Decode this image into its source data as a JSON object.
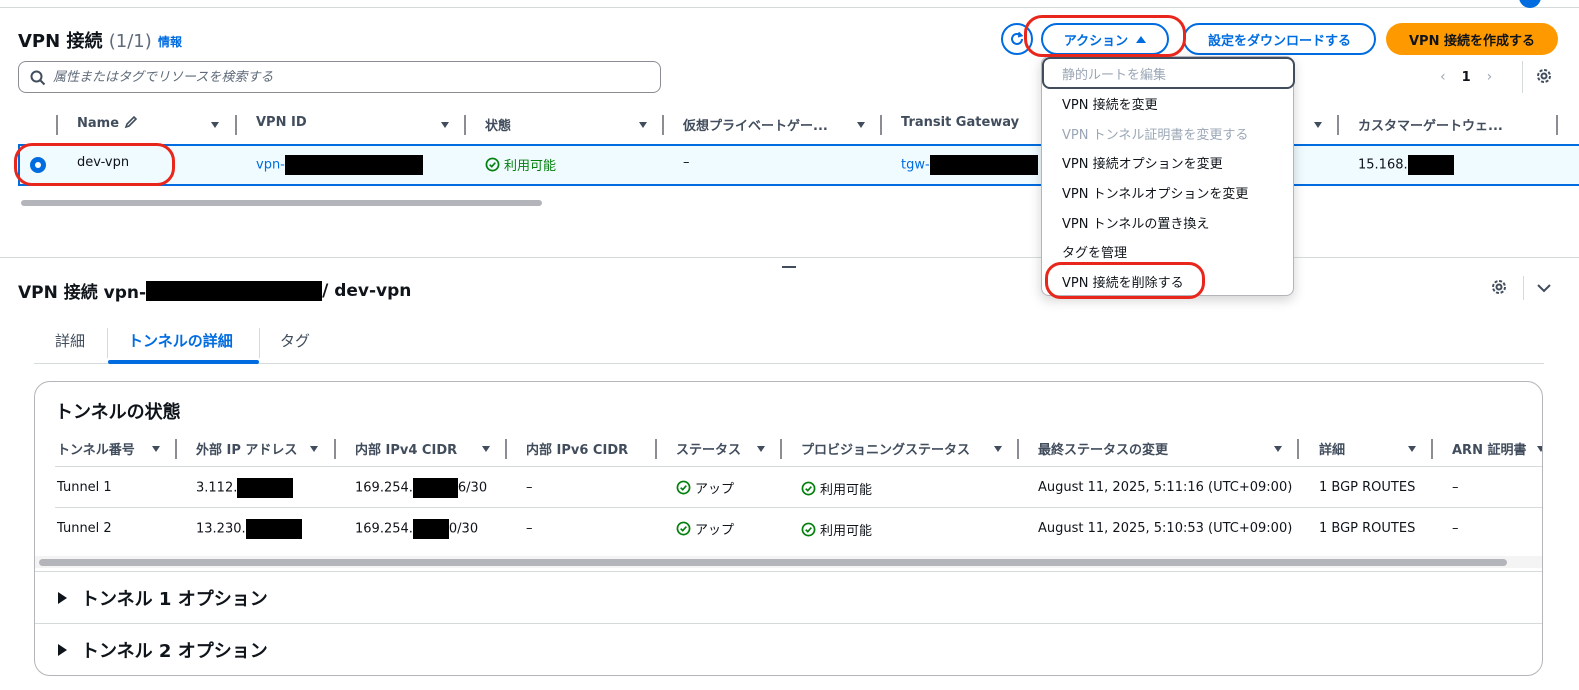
{
  "header": {
    "title": "VPN 接続",
    "count": "(1/1)",
    "info": "情報",
    "action_label": "アクション",
    "download_label": "設定をダウンロードする",
    "create_label": "VPN 接続を作成する"
  },
  "search": {
    "placeholder": "属性またはタグでリソースを検索する"
  },
  "pagination": {
    "page": "1"
  },
  "table": {
    "columns": [
      "Name",
      "VPN ID",
      "状態",
      "仮想プライベートゲー...",
      "Transit Gateway",
      "カスタマーゲートウェ..."
    ],
    "row": {
      "name": "dev-vpn",
      "vpn_id_prefix": "vpn-",
      "status": "利用可能",
      "vgw": "–",
      "tgw_prefix": "tgw-",
      "cgw_prefix": "15.168."
    }
  },
  "menu": {
    "items": [
      {
        "label": "静的ルートを編集",
        "disabled": true
      },
      {
        "label": "VPN 接続を変更",
        "disabled": false
      },
      {
        "label": "VPN トンネル証明書を変更する",
        "disabled": true
      },
      {
        "label": "VPN 接続オプションを変更",
        "disabled": false
      },
      {
        "label": "VPN トンネルオプションを変更",
        "disabled": false
      },
      {
        "label": "VPN トンネルの置き換え",
        "disabled": false
      },
      {
        "label": "タグを管理",
        "disabled": false
      },
      {
        "label": "VPN 接続を削除する",
        "disabled": false
      }
    ]
  },
  "detail": {
    "title_prefix": "VPN 接続 vpn-",
    "title_suffix": "/ dev-vpn",
    "tabs": [
      "詳細",
      "トンネルの詳細",
      "タグ"
    ],
    "active_tab": "トンネルの詳細"
  },
  "tunnels": {
    "title": "トンネルの状態",
    "columns": [
      "トンネル番号",
      "外部 IP アドレス",
      "内部 IPv4 CIDR",
      "内部 IPv6 CIDR",
      "ステータス",
      "プロビジョニングステータス",
      "最終ステータスの変更",
      "詳細",
      "ARN 証明書"
    ],
    "rows": [
      {
        "number": "Tunnel 1",
        "outside_ip_prefix": "3.112.",
        "inside_cidr_prefix": "169.254.",
        "inside_cidr_suffix": "6/30",
        "ipv6": "–",
        "status": "アップ",
        "provisioning": "利用可能",
        "last_change": "August 11, 2025, 5:11:16 (UTC+09:00)",
        "detail": "1 BGP ROUTES",
        "arn": "–"
      },
      {
        "number": "Tunnel 2",
        "outside_ip_prefix": "13.230.",
        "inside_cidr_prefix": "169.254.",
        "inside_cidr_suffix": "0/30",
        "ipv6": "–",
        "status": "アップ",
        "provisioning": "利用可能",
        "last_change": "August 11, 2025, 5:10:53 (UTC+09:00)",
        "detail": "1 BGP ROUTES",
        "arn": "–"
      }
    ]
  },
  "options": {
    "tunnel1": "トンネル 1 オプション",
    "tunnel2": "トンネル 2 オプション"
  },
  "colors": {
    "link": "#006ce0",
    "primary_button": "#ff9900",
    "success": "#037f0c",
    "annotation": "#e8261b"
  }
}
